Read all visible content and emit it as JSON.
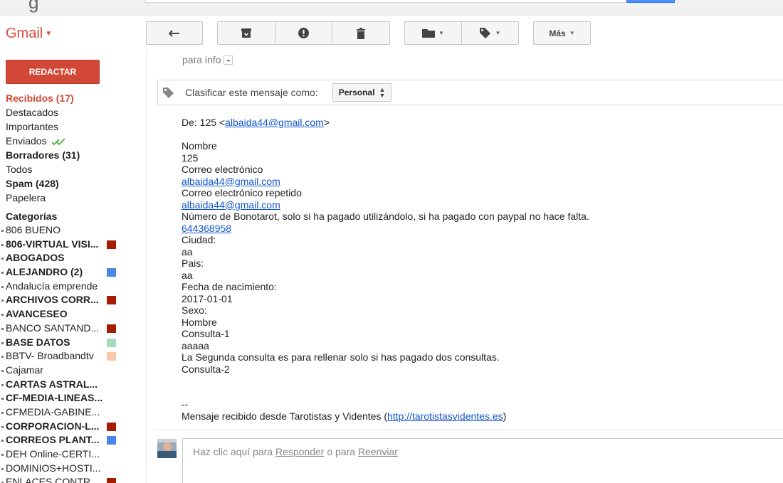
{
  "top": {
    "logo_fragment": "g"
  },
  "header": {
    "app_menu": "Gmail",
    "more_button": "Más"
  },
  "toolbar": {
    "icons": [
      "reply-icon",
      "archive-icon",
      "report-spam-icon",
      "delete-icon",
      "folder-icon",
      "label-icon"
    ]
  },
  "sidebar": {
    "compose_label": "REDACTAR",
    "items": [
      {
        "label": "Recibidos (17)",
        "style": "red"
      },
      {
        "label": "Destacados",
        "style": "normal"
      },
      {
        "label": "Importantes",
        "style": "normal"
      },
      {
        "label": "Enviados",
        "style": "normal"
      },
      {
        "label": "Borradores (31)",
        "style": "bold"
      },
      {
        "label": "Todos",
        "style": "normal"
      },
      {
        "label": "Spam (428)",
        "style": "bold"
      },
      {
        "label": "Papelera",
        "style": "normal"
      }
    ],
    "categories_header": "Categorías",
    "categories": [
      {
        "label": "806 BUENO",
        "bold": false,
        "color": ""
      },
      {
        "label": "806-VIRTUAL VISI...",
        "bold": true,
        "color": "#a61c00"
      },
      {
        "label": "ABOGADOS",
        "bold": true,
        "color": ""
      },
      {
        "label": "ALEJANDRO (2)",
        "bold": true,
        "color": "#4a86e8"
      },
      {
        "label": "Andalucía emprende",
        "bold": false,
        "color": ""
      },
      {
        "label": "ARCHIVOS CORR...",
        "bold": true,
        "color": "#a61c00"
      },
      {
        "label": "AVANCESEO",
        "bold": true,
        "color": ""
      },
      {
        "label": "BANCO SANTAND...",
        "bold": false,
        "color": "#a61c00"
      },
      {
        "label": "BASE DATOS",
        "bold": true,
        "color": "#a8dbbd"
      },
      {
        "label": "BBTV- Broadbandtv",
        "bold": false,
        "color": "#f8c8a8"
      },
      {
        "label": "Cajamar",
        "bold": false,
        "color": ""
      },
      {
        "label": "CARTAS ASTRAL...",
        "bold": true,
        "color": ""
      },
      {
        "label": "CF-MEDIA-LINEAS...",
        "bold": true,
        "color": ""
      },
      {
        "label": "CFMEDIA-GABINE...",
        "bold": false,
        "color": ""
      },
      {
        "label": "CORPORACION-L...",
        "bold": true,
        "color": "#a61c00"
      },
      {
        "label": "CORREOS PLANT...",
        "bold": true,
        "color": "#4a86e8"
      },
      {
        "label": "DEH Online-CERTI...",
        "bold": false,
        "color": ""
      },
      {
        "label": "DOMINIOS+HOSTI...",
        "bold": false,
        "color": ""
      },
      {
        "label": "ENLACES CONTR...",
        "bold": false,
        "color": "#a61c00"
      }
    ]
  },
  "message": {
    "to_line": "para info",
    "classify_label": "Clasificar este mensaje como:",
    "classify_value": "Personal",
    "from_prefix": "De: 125 <",
    "from_email": "albaida44@gmail.com",
    "from_suffix": ">",
    "lines": [
      {
        "text": "Nombre",
        "link": false
      },
      {
        "text": "125",
        "link": false
      },
      {
        "text": "Correo electrónico",
        "link": false
      },
      {
        "text": "albaida44@gmail.com",
        "link": true
      },
      {
        "text": "Correo electrónico repetido",
        "link": false
      },
      {
        "text": "albaida44@gmail.com",
        "link": true
      },
      {
        "text": "Número de Bonotarot, solo si ha pagado utilizándolo, si ha pagado con paypal no hace falta.",
        "link": false
      },
      {
        "text": "644368958",
        "link": true
      },
      {
        "text": "Ciudad:",
        "link": false
      },
      {
        "text": "aa",
        "link": false
      },
      {
        "text": "Pais:",
        "link": false
      },
      {
        "text": "aa",
        "link": false
      },
      {
        "text": "Fecha de nacimiento:",
        "link": false
      },
      {
        "text": "2017-01-01",
        "link": false
      },
      {
        "text": "Sexo:",
        "link": false
      },
      {
        "text": "Hombre",
        "link": false
      },
      {
        "text": "Consulta-1",
        "link": false
      },
      {
        "text": "aaaaa",
        "link": false
      },
      {
        "text": "La Segunda consulta es para rellenar solo si has pagado dos consultas.",
        "link": false
      },
      {
        "text": "Consulta-2",
        "link": false
      }
    ],
    "signature_dash": "--",
    "footer_prefix": "Mensaje recibido desde Tarotistas y Videntes (",
    "footer_link": "http://tarotistasvidentes.es",
    "footer_suffix": ")"
  },
  "reply": {
    "prefix": "Haz clic aquí para ",
    "reply_link": "Responder",
    "middle": " o para ",
    "forward_link": "Reenviar"
  }
}
